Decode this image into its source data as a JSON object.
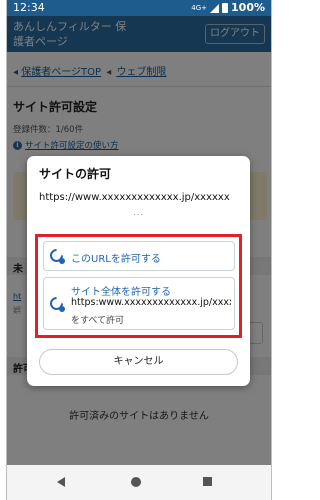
{
  "status_bar": {
    "time": "12:34",
    "network": "4G+",
    "battery": "100%"
  },
  "header": {
    "title": "あんしんフィルター 保護者ページ",
    "logout_label": "ログアウト"
  },
  "breadcrumbs": {
    "item1": "保護者ページTOP",
    "item2": "ウェブ制限"
  },
  "page": {
    "title": "サイト許可設定",
    "registered_count": "登録件数：1/60件",
    "howto_link": "サイト許可設定の使い方",
    "section1_label": "未",
    "section2_label": "許可",
    "empty_message": "許可済みのサイトはありません"
  },
  "dialog": {
    "title": "サイトの許可",
    "url": "https://www.xxxxxxxxxxxxx.jp/xxxxxx",
    "ellipsis": "...",
    "option1_label": "このURLを許可する",
    "option2_label": "サイト全体を許可する",
    "option2_url": "https:www.xxxxxxxxxxxxx.jp/xxxxxx",
    "option2_sub": "をすべて許可",
    "cancel_label": "キャンセル"
  },
  "colors": {
    "header": "#2c6fa5",
    "highlight": "#e0202b",
    "option_text": "#1f64b3"
  }
}
